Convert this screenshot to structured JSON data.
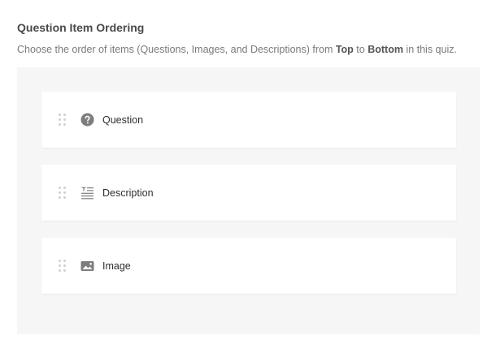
{
  "section": {
    "title": "Question Item Ordering",
    "description_parts": {
      "before": "Choose the order of items (Questions, Images, and Descriptions) from ",
      "top": "Top",
      "middle": " to ",
      "bottom": "Bottom",
      "after": " in this quiz."
    }
  },
  "items": [
    {
      "label": "Question",
      "icon": "question-circle-icon"
    },
    {
      "label": "Description",
      "icon": "text-lines-icon"
    },
    {
      "label": "Image",
      "icon": "image-icon"
    }
  ],
  "colors": {
    "icon": "#7d7d7d",
    "panel_bg": "#f6f6f6",
    "card_bg": "#ffffff"
  }
}
